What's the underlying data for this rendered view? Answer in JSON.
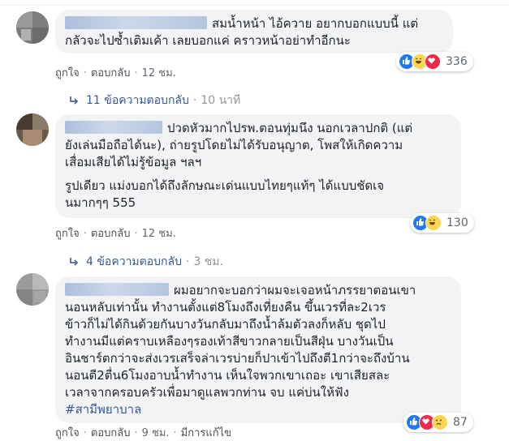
{
  "comments": [
    {
      "lines": [
        "สมน้ำหน้า ไอ้ควาย อยากบอกแบบนี้ แต่",
        "กลัวจะไปซ้ำเติมเค้า เลยบอกแค่ คราวหน้าอย่าทำอีกนะ"
      ],
      "reaction_count": "336",
      "like_label": "ถูกใจ",
      "reply_label": "ตอบกลับ",
      "time": "12 ชม.",
      "replies_text": "11 ข้อความตอบกลับ",
      "replies_time": "10 นาที"
    },
    {
      "lines": [
        "ปวดหัวมากไปรพ.ตอนทุ่มนึง นอกเวลาปกติ (แต่",
        "ยังเล่นมือถือได้นะ), ถ่ายรูปโดยไม่ได้รับอนุญาต, โพสให้เกิดความ",
        "เสื่อมเสียได้ไม่รู้ข้อมูล ฯลฯ",
        "รูปเดียว แม่งบอกได้ถึงลักษณะเด่นแบบไทยๆแท้ๆ ได้แบบชัดเจ",
        "นมากๆๆ 555"
      ],
      "reaction_count": "130",
      "like_label": "ถูกใจ",
      "reply_label": "ตอบกลับ",
      "time": "12 ชม.",
      "replies_text": "4 ข้อความตอบกลับ",
      "replies_time": "3 ชม."
    },
    {
      "lines": [
        "ผมอยากจะบอกว่าผมจะเจอหน้าภรรยาตอนเขา",
        "นอนหลับเท่านั้น ทำงานตั้งแต่8โมงถึงเที่ยงคืน ขึ้นเวรที่ละ2เวร",
        "ข้าวก็ไม่ได้กินด้วยกันบางวันกลับมาถึงน้ำล้มตัวลงก็หลับ ชุดไป",
        "ทำงานมีแต่คราบเหลืองๆรองเท้าสีขาวกลายเป็นสีฝุ่น บางวันเป็น",
        "อินชาร์ตกว่าจะส่งเวรเสร็จล่าเวรบ่ายก็ปาเข้าไปถึงตี1กว่าจะถึงบ้าน",
        "นอนตี2ตื่น6โมงอาบน้ำทำงาน เห็นใจพวกเขาเถอะ เขาเสียสละ",
        "เวลาจากครอบครัวเพื่อมาดูแลพวกท่าน จบ แค่บ่นให้ฟัง",
        "#สามีพยาบาล"
      ],
      "reaction_count": "87",
      "like_label": "ถูกใจ",
      "reply_label": "ตอบกลับ",
      "time": "9 ชม.",
      "edited_label": "มีการแก้ไข"
    }
  ],
  "colors": {
    "link": "#365899",
    "bubble": "#f2f3f5",
    "like": "#2078f4",
    "love": "#f0284a",
    "haha": "#fcd44f"
  }
}
